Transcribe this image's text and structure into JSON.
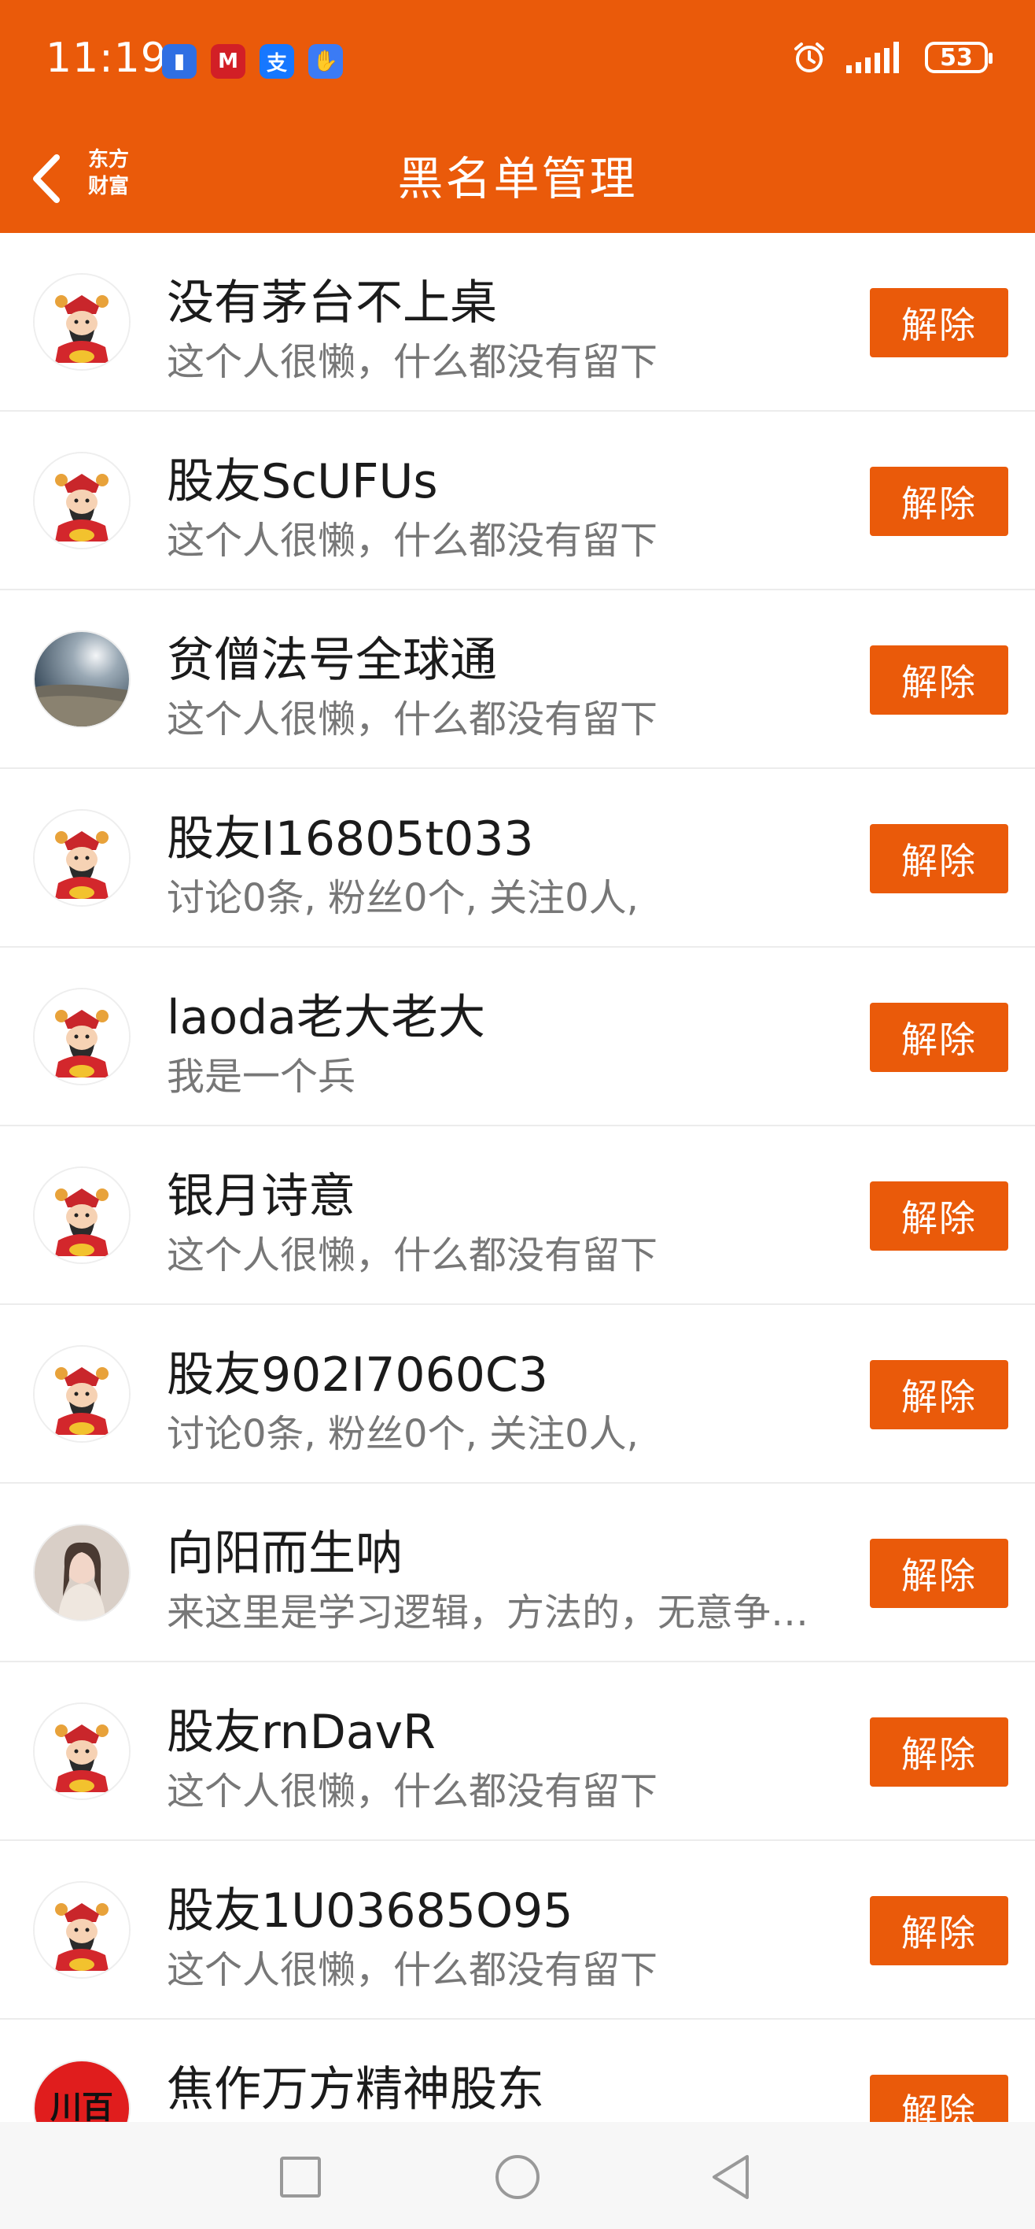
{
  "status_bar": {
    "time": "11:19",
    "battery": "53",
    "apps": [
      {
        "icon": "voice-app-icon",
        "glyph": "▮",
        "color": "#2f6fe3"
      },
      {
        "icon": "metro-app-icon",
        "glyph": "M",
        "color": "#d21f26"
      },
      {
        "icon": "alipay-icon",
        "glyph": "支",
        "color": "#1677ff"
      },
      {
        "icon": "hand-app-icon",
        "glyph": "✋",
        "color": "#3b7bf5"
      }
    ]
  },
  "header": {
    "title": "黑名单管理",
    "logo_line1": "东方",
    "logo_line2": "财富",
    "accent_color": "#ea5a0a"
  },
  "button_label": "解除",
  "users": [
    {
      "name": "没有茅台不上桌",
      "desc": "这个人很懒，什么都没有留下",
      "avatar": "fortune"
    },
    {
      "name": "股友ScUFUs",
      "desc": "这个人很懒，什么都没有留下",
      "avatar": "fortune"
    },
    {
      "name": "贫僧法号全球通",
      "desc": "这个人很懒，什么都没有留下",
      "avatar": "beach"
    },
    {
      "name": "股友I16805t033",
      "desc": "讨论0条, 粉丝0个, 关注0人,",
      "avatar": "fortune"
    },
    {
      "name": "laoda老大老大",
      "desc": "我是一个兵",
      "avatar": "fortune"
    },
    {
      "name": "银月诗意",
      "desc": "这个人很懒，什么都没有留下",
      "avatar": "fortune"
    },
    {
      "name": "股友902I7060C3",
      "desc": "讨论0条, 粉丝0个, 关注0人,",
      "avatar": "fortune"
    },
    {
      "name": "向阳而生呐",
      "desc": "来这里是学习逻辑，方法的，无意争…",
      "avatar": "portrait"
    },
    {
      "name": "股友rnDavR",
      "desc": "这个人很懒，什么都没有留下",
      "avatar": "fortune"
    },
    {
      "name": "股友1U03685O95",
      "desc": "这个人很懒，什么都没有留下",
      "avatar": "fortune"
    },
    {
      "name": "焦作万方精神股东",
      "desc": "",
      "avatar": "red"
    }
  ]
}
